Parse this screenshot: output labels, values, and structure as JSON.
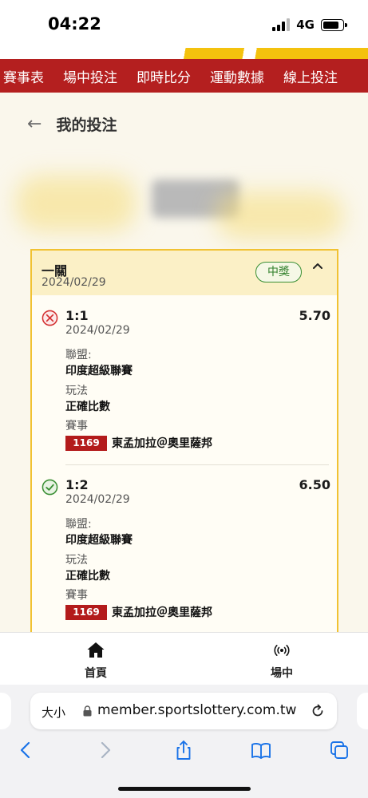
{
  "status_bar": {
    "time": "04:22",
    "network": "4G"
  },
  "topnav": {
    "items": [
      "賽事表",
      "場中投注",
      "即時比分",
      "運動數據",
      "線上投注"
    ]
  },
  "header": {
    "title": "我的投注"
  },
  "bet_card": {
    "type": "一關",
    "date": "2024/02/29",
    "result_badge": "中獎",
    "bets": [
      {
        "status": "lost",
        "selection": "1:1",
        "odds": "5.70",
        "date": "2024/02/29",
        "league_label": "聯盟:",
        "league": "印度超級聯賽",
        "market_label": "玩法",
        "market": "正確比數",
        "event_label": "賽事",
        "match_code": "1169",
        "match_name": "東孟加拉＠奧里薩邦"
      },
      {
        "status": "won",
        "selection": "1:2",
        "odds": "6.50",
        "date": "2024/02/29",
        "league_label": "聯盟:",
        "league": "印度超級聯賽",
        "market_label": "玩法",
        "market": "正確比數",
        "event_label": "賽事",
        "match_code": "1169",
        "match_name": "東孟加拉＠奧里薩邦"
      }
    ]
  },
  "tabbar": {
    "home_label": "首頁",
    "live_label": "場中"
  },
  "browser": {
    "text_size": "大小",
    "url": "member.sportslottery.com.tw"
  },
  "colors": {
    "brand_red": "#b41f1f",
    "accent_yellow": "#f1c232",
    "win_green": "#3a8f34",
    "lose_red": "#d32f2f"
  }
}
